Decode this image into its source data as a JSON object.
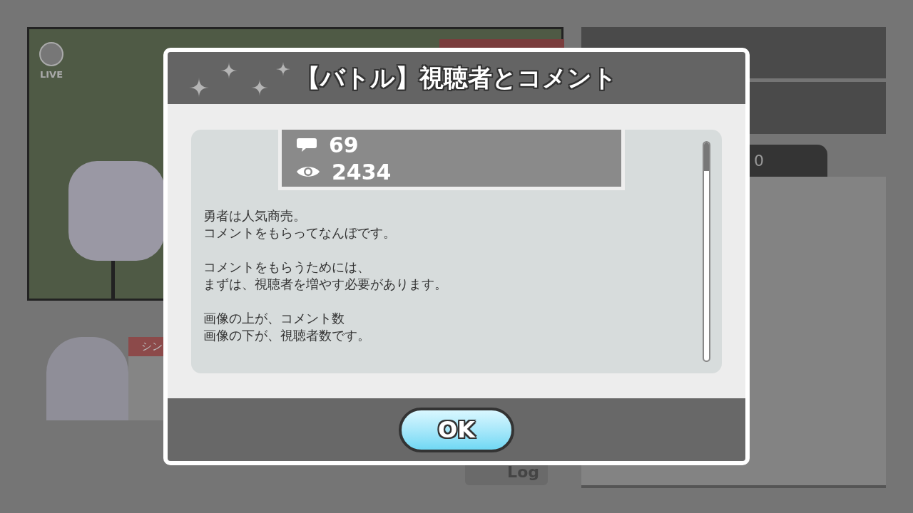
{
  "background": {
    "live_label": "LIVE",
    "tab_count": "0",
    "side_banner": "シン",
    "log_button": "Log"
  },
  "dialog": {
    "title": "【バトル】視聴者とコメント",
    "stats": [
      {
        "kind": "comments",
        "value": "69"
      },
      {
        "kind": "viewers",
        "value": "2434"
      }
    ],
    "paragraphs": [
      [
        "勇者は人気商売。",
        "コメントをもらってなんぼです。"
      ],
      [
        "コメントをもらうためには、",
        "まずは、視聴者を増やす必要があります。"
      ],
      [
        "画像の上が、コメント数",
        "画像の下が、視聴者数です。"
      ]
    ],
    "button": "OK"
  }
}
